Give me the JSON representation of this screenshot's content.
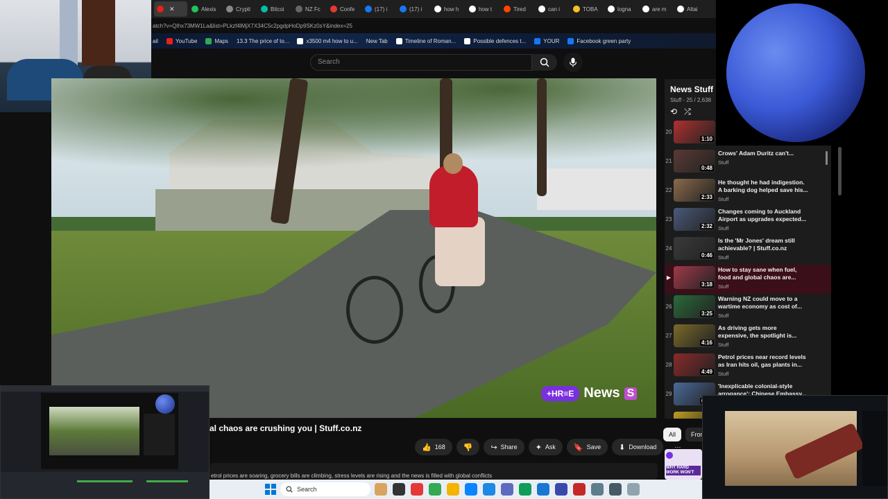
{
  "browser": {
    "tabs": [
      {
        "label": "",
        "color": "#e62117",
        "active": true
      },
      {
        "label": "Alexis",
        "color": "#21c25e"
      },
      {
        "label": "Crypti",
        "color": "#888888"
      },
      {
        "label": "Bitcoi",
        "color": "#00bfa5"
      },
      {
        "label": "NZ Fc",
        "color": "#666666"
      },
      {
        "label": "Confe",
        "color": "#e53935"
      },
      {
        "label": "(17) i",
        "color": "#1877f2"
      },
      {
        "label": "(17) i",
        "color": "#1877f2"
      },
      {
        "label": "how h",
        "color": "#ffffff"
      },
      {
        "label": "how t",
        "color": "#ffffff"
      },
      {
        "label": "Tired",
        "color": "#ff4500"
      },
      {
        "label": "can i",
        "color": "#ffffff"
      },
      {
        "label": "TOBA",
        "color": "#f6c026"
      },
      {
        "label": "logna",
        "color": "#ffffff"
      },
      {
        "label": "are m",
        "color": "#ffffff"
      },
      {
        "label": "Altai",
        "color": "#ffffff"
      }
    ],
    "close_glyph": "✕",
    "address": "atch?v=QIhx73MW1La&list=PLkzf4lMjX7X34C5c2pgdpHoDp9SKz0sY&index=25",
    "bookmarks": [
      {
        "label": "ail",
        "color": ""
      },
      {
        "label": "YouTube",
        "color": "#e62117"
      },
      {
        "label": "Maps",
        "color": "#34a853"
      },
      {
        "label": "13.3 The price of to...",
        "color": ""
      },
      {
        "label": "x3500 m4 how to u...",
        "color": "#ffffff"
      },
      {
        "label": "New Tab",
        "color": ""
      },
      {
        "label": "Timeline of Roman...",
        "color": "#ffffff"
      },
      {
        "label": "Possible defences t...",
        "color": "#ffffff"
      },
      {
        "label": "YOUR",
        "color": "#1877f2"
      },
      {
        "label": "Facebook green party",
        "color": "#1877f2"
      }
    ]
  },
  "youtube": {
    "search_placeholder": "Search",
    "search_icon": "search-icon",
    "mic_icon": "mic-icon",
    "video": {
      "brand_pill": "+HR≡E",
      "brand_word": "News",
      "brand_s": "S",
      "title": "al chaos are crushing you | Stuff.co.nz",
      "likes": "168",
      "share": "Share",
      "ask": "Ask",
      "save": "Save",
      "download": "Download",
      "more": "···",
      "description": "etrol prices are soaring, grocery bills are climbing, stress levels are rising and the news is filled with global conflicts"
    },
    "chips": [
      "All",
      "From"
    ],
    "playlist": {
      "title": "News Stuff",
      "subtitle": "Stuff - 25 / 2,638",
      "items": [
        {
          "index": "20",
          "title": "",
          "channel": "",
          "duration": "1:10",
          "thumb": "#b03030",
          "active": false
        },
        {
          "index": "21",
          "title": "Crows' Adam Duritz can't...",
          "channel": "Stuff",
          "duration": "0:48",
          "thumb": "#5a3a34",
          "active": false
        },
        {
          "index": "22",
          "title": "He thought he had indigestion. A barking dog helped save his...",
          "channel": "Stuff",
          "duration": "2:33",
          "thumb": "#8a6a4a",
          "active": false
        },
        {
          "index": "23",
          "title": "Changes coming to Auckland Airport as upgrades expected...",
          "channel": "Stuff",
          "duration": "2:32",
          "thumb": "#4a5a7a",
          "active": false
        },
        {
          "index": "24",
          "title": "Is the 'Mr Jones' dream still achievable? | Stuff.co.nz",
          "channel": "Stuff",
          "duration": "0:46",
          "thumb": "#3a3a3a",
          "active": false
        },
        {
          "index": "▶",
          "title": "How to stay sane when fuel, food and global chaos are...",
          "channel": "Stuff",
          "duration": "3:18",
          "thumb": "#a03a4a",
          "active": true
        },
        {
          "index": "26",
          "title": "Warning NZ could move to a wartime economy as cost of...",
          "channel": "Stuff",
          "duration": "3:25",
          "thumb": "#2a6a3a",
          "active": false
        },
        {
          "index": "27",
          "title": "As driving gets more expensive, the spotlight is...",
          "channel": "Stuff",
          "duration": "4:16",
          "thumb": "#7a6a2a",
          "active": false
        },
        {
          "index": "28",
          "title": "Petrol prices near record levels as Iran hits oil, gas plants in...",
          "channel": "Stuff",
          "duration": "4:49",
          "thumb": "#8a2a2a",
          "active": false
        },
        {
          "index": "29",
          "title": "'Inexplicable colonial-style arrogance': Chinese Embassy...",
          "channel": "Stuff",
          "duration": "6:41",
          "thumb": "#4a6a9a",
          "active": false
        },
        {
          "index": "30",
          "title": "",
          "channel": "",
          "duration": "",
          "thumb": "#c0a020",
          "active": false
        }
      ]
    },
    "ad_text": "WHY HARD WORK WON'T"
  },
  "taskbar": {
    "search": "Search",
    "icons": [
      "#d9a460",
      "#333333",
      "#e53935",
      "#34a853",
      "#f4b400",
      "#0a84ff",
      "#1e88e5",
      "#5c6bc0",
      "#0f9d58",
      "#1976d2",
      "#3949ab",
      "#c62828",
      "#607d8b",
      "#455a64",
      "#90a4ae"
    ]
  }
}
